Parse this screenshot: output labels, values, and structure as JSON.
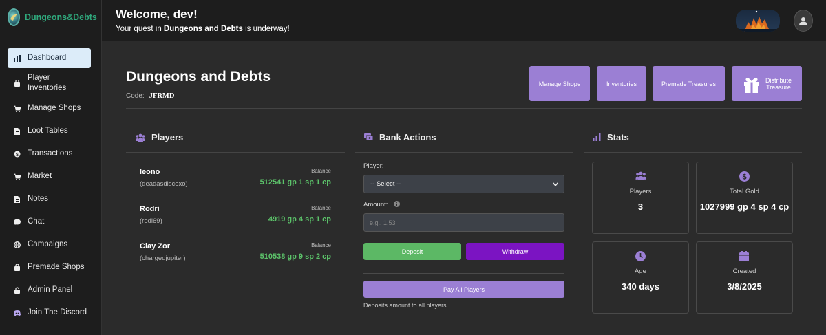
{
  "brand": {
    "name": "Dungeons&Debts"
  },
  "sidebar": {
    "items": [
      {
        "label": "Dashboard",
        "icon": "bar-chart-icon",
        "active": true
      },
      {
        "label": "Player Inventories",
        "icon": "bag-icon"
      },
      {
        "label": "Manage Shops",
        "icon": "cart-icon"
      },
      {
        "label": "Loot Tables",
        "icon": "file-icon"
      },
      {
        "label": "Transactions",
        "icon": "coin-icon"
      },
      {
        "label": "Market",
        "icon": "cart-icon"
      },
      {
        "label": "Notes",
        "icon": "file-icon"
      },
      {
        "label": "Chat",
        "icon": "chat-icon"
      },
      {
        "label": "Campaigns",
        "icon": "globe-icon"
      },
      {
        "label": "Premade Shops",
        "icon": "bag-icon"
      },
      {
        "label": "Admin Panel",
        "icon": "lock-icon"
      },
      {
        "label": "Join The Discord",
        "icon": "discord-icon"
      }
    ]
  },
  "topbar": {
    "welcome": "Welcome, dev!",
    "quest_prefix": "Your quest in ",
    "quest_campaign": "Dungeons and Debts",
    "quest_suffix": " is underway!"
  },
  "campaign": {
    "title": "Dungeons and Debts",
    "code_label": "Code:",
    "code": "JFRMD"
  },
  "header_buttons": {
    "manage_shops": "Manage Shops",
    "inventories": "Inventories",
    "premade_treasures": "Premade Treasures",
    "distribute_line1": "Distribute",
    "distribute_line2": "Treasure"
  },
  "players_section": {
    "title": "Players",
    "balance_label": "Balance",
    "players": [
      {
        "name": "leono",
        "username": "(deadasdiscoxo)",
        "balance": "512541 gp 1 sp 1 cp"
      },
      {
        "name": "Rodri",
        "username": "(rodi69)",
        "balance": "4919 gp 4 sp 1 cp"
      },
      {
        "name": "Clay Zor",
        "username": "(chargedjupiter)",
        "balance": "510538 gp 9 sp 2 cp"
      }
    ]
  },
  "bank_section": {
    "title": "Bank Actions",
    "player_label": "Player:",
    "player_selected": "-- Select --",
    "amount_label": "Amount:",
    "amount_placeholder": "e.g., 1.53",
    "deposit": "Deposit",
    "withdraw": "Withdraw",
    "pay_all": "Pay All Players",
    "pay_all_note": "Deposits amount to all players."
  },
  "stats_section": {
    "title": "Stats",
    "cards": [
      {
        "label": "Players",
        "value": "3",
        "icon": "users-icon"
      },
      {
        "label": "Total Gold",
        "value": "1027999 gp 4 sp 4 cp",
        "icon": "dollar-coin-icon"
      },
      {
        "label": "Age",
        "value": "340 days",
        "icon": "clock-icon"
      },
      {
        "label": "Created",
        "value": "3/8/2025",
        "icon": "calendar-icon"
      }
    ]
  },
  "colors": {
    "accent": "#9b7fd4",
    "deposit": "#5cb865",
    "withdraw": "#7b14c2",
    "balance": "#5cc36a",
    "brand": "#2fa87c"
  }
}
